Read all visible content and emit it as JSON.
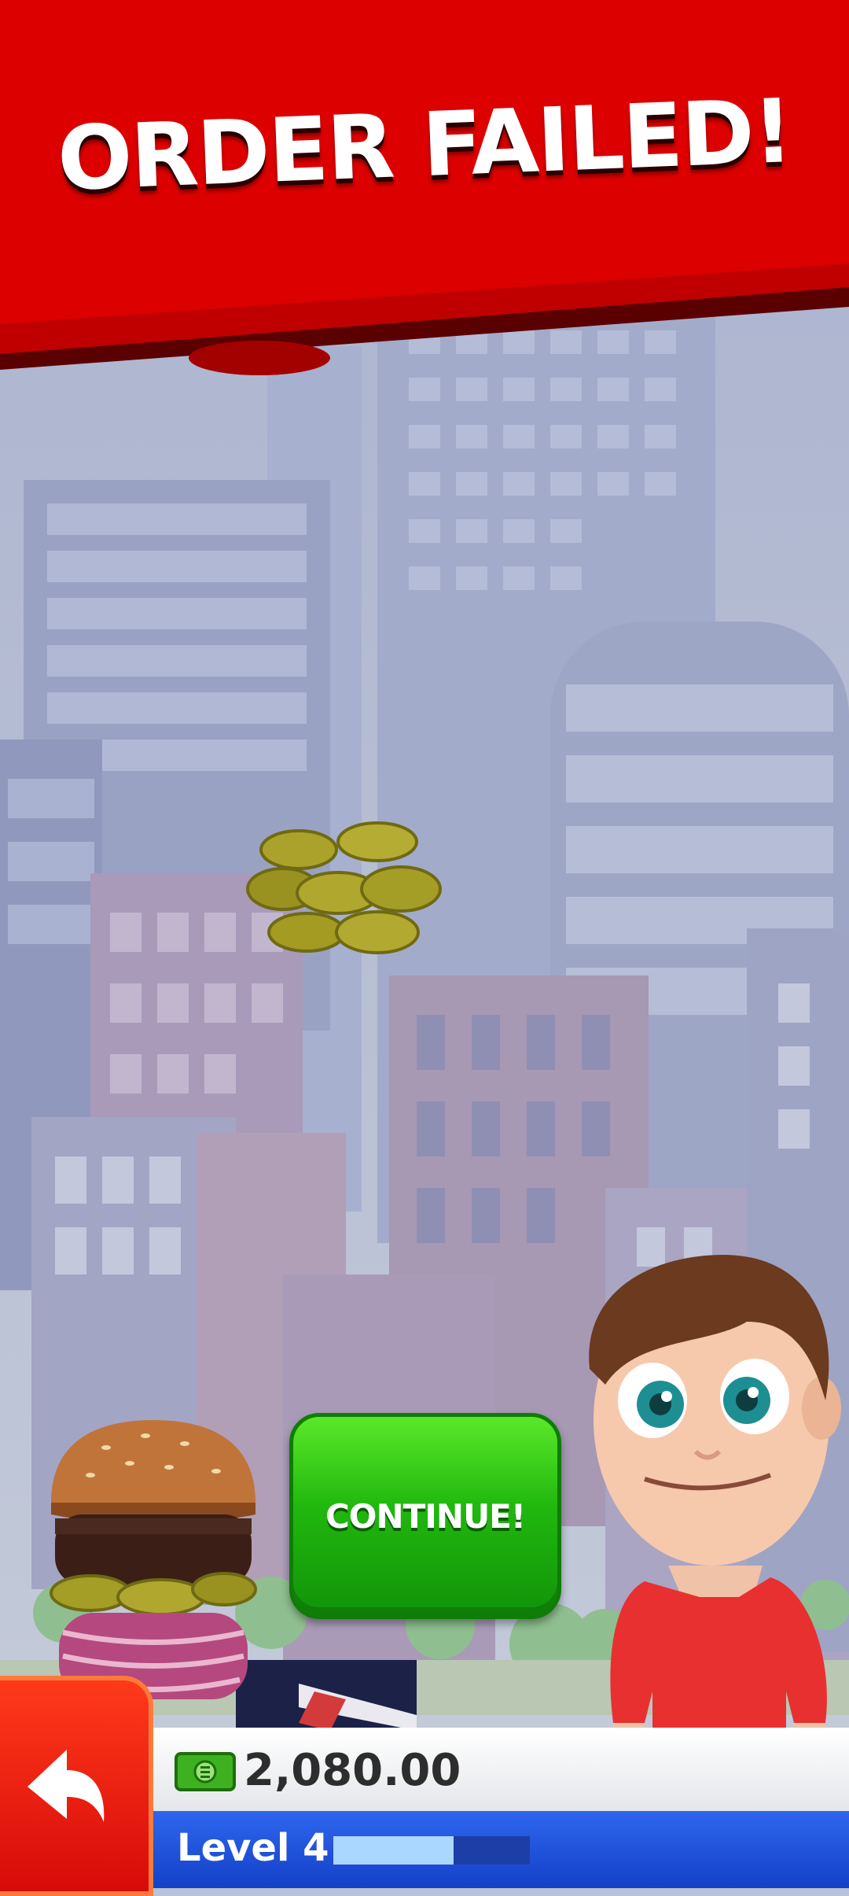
{
  "banner": {
    "title": "ORDER FAILED!"
  },
  "continue_button": {
    "label": "CONTINUE!"
  },
  "hud": {
    "money": "2,080.00",
    "level_label": "Level 4",
    "level_progress": 0.61
  },
  "icons": {
    "back": "back-arrow-icon",
    "money": "cash-icon",
    "flying_item": "pickles-icon",
    "burger": "burger-stack-icon",
    "customer": "customer-character"
  },
  "colors": {
    "banner_red": "#d60000",
    "button_green": "#21b80e",
    "hud_blue": "#1e4fe0"
  }
}
